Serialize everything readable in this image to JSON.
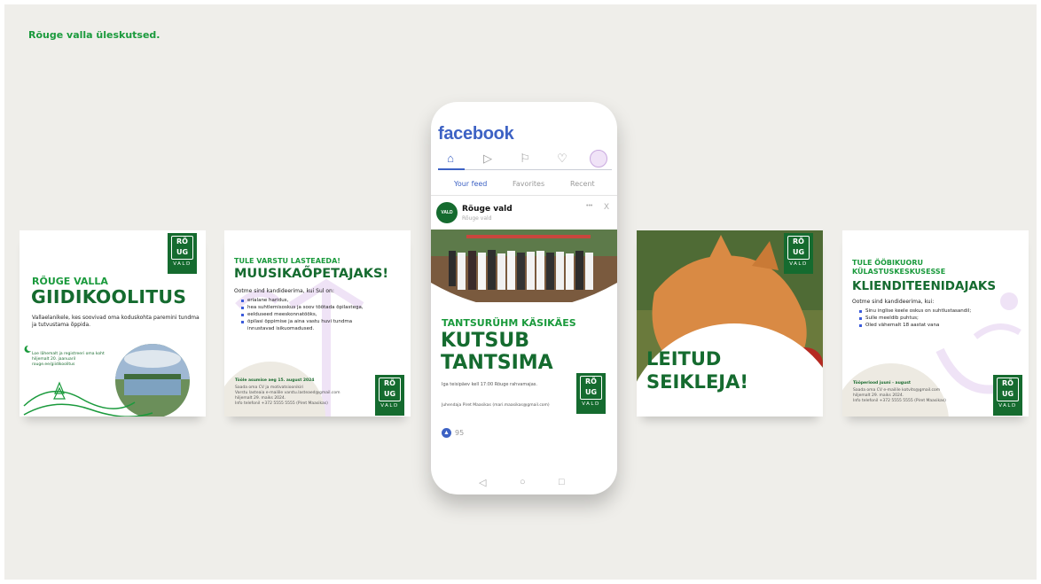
{
  "page": {
    "title": "Rõuge valla üleskutsed."
  },
  "brand": {
    "green": "#1a9a3c",
    "dark_green": "#156b2f",
    "fb_blue": "#3d62c4"
  },
  "logo": {
    "mark": "RÕ UG",
    "word": "VALD"
  },
  "cards": {
    "c1": {
      "kicker": "RÕUGE VALLA",
      "headline": "GIIDIKOOLITUS",
      "text": "Vallaelanikele, kes soovivad oma koduskohta paremini tundma ja tutvustama õppida.",
      "fine": "Loe lähemalt ja registreeri oma koht hiljemalt 20. jaanuaril rouge.ee/giidikoolitus"
    },
    "c2": {
      "kicker": "TULE VARSTU LASTEAEDA!",
      "headline": "MUUSIKAÕPETAJAKS!",
      "lead": "Ootme sind kandideerima, kui Sul on:",
      "bullets": [
        "erialane haridus,",
        "hea suhtlemisoskus ja soov töötada õpilastega,",
        "eelduseed meeskonnatööks,",
        "õpilasi õppimise ja aina vastu huvi tundma innustavad isikuomadused."
      ],
      "fine1": "Tööle asumise aeg 15. august 2024",
      "fine2": "Saada oma CV ja motivatsioonikiri\nVarstu lasteaia e-mailile varstu.lasteaed@gmail.com\nhiljemalt 29. maiks 2024.\nInfo telefonil +372 5555 5555 (Piret Maasikas)"
    },
    "c4": {
      "headline_l1": "LEITUD",
      "headline_l2": "SEIKLEJA!"
    },
    "c5": {
      "kicker_l1": "TULE ÖÖBIKUORU",
      "kicker_l2": "KÜLASTUSKESKUSESSE",
      "headline": "KLIENDITEENIDAJAKS",
      "lead": "Ootme sind kandideerima, kui:",
      "bullets": [
        "Sinu inglise keele oskus on suhtlustasandil;",
        "Sulle meeldib puhtus;",
        "Oled vähemalt 18 aastat vana"
      ],
      "fine1": "Tööperiood juuni - august",
      "fine2": "Saada oma CV e-mailile kotvits@gmail.com\nhiljemalt 29. maiks 2024.\nInfo telefonil +372 5555 5555 (Piret Maasikas)"
    }
  },
  "phone": {
    "app_title": "facebook",
    "tabs": [
      "Your feed",
      "Favorites",
      "Recent"
    ],
    "post": {
      "author": "Rõuge vald",
      "sub": "Rõuge vald",
      "menu": "•••",
      "close": "X",
      "kicker": "TANTSURÜHM KÄSIKÄES",
      "headline_l1": "KUTSUB",
      "headline_l2": "TANTSIMA",
      "text": "Iga teisipäev kell 17:00 Rõuge rahvamajas.",
      "fine": "Juhendaja Piret Maasikas (mari.maasikas@gmail.com)",
      "likes": "95"
    }
  },
  "icons": {
    "nav": [
      "home-icon",
      "video-icon",
      "flag-icon",
      "bell-icon",
      "profile-avatar"
    ],
    "bottom": [
      "back-icon",
      "home-circle-icon",
      "recents-icon"
    ]
  }
}
